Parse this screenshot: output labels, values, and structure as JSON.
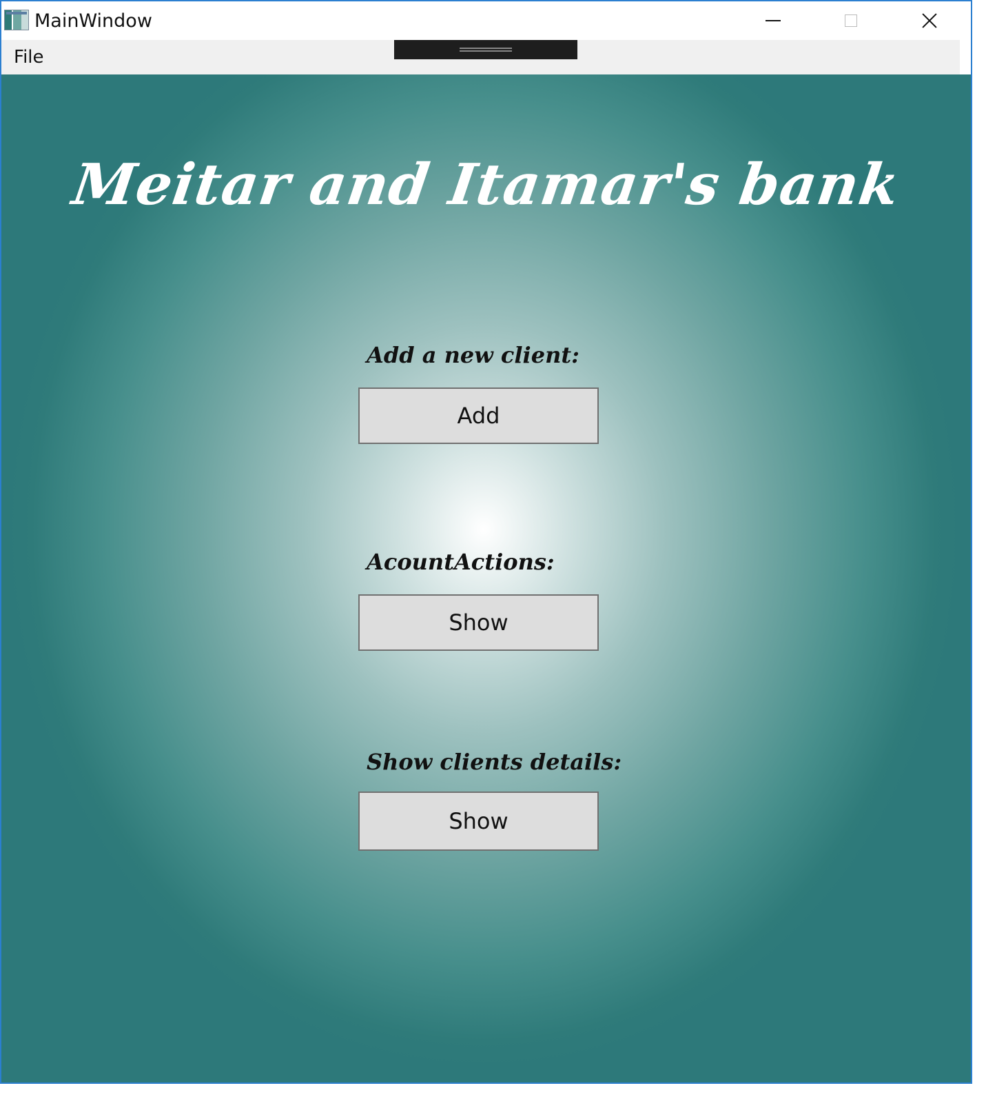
{
  "window": {
    "title": "MainWindow",
    "accent_border_color": "#2b7fd0",
    "controls": {
      "minimize_icon": "minimize-icon",
      "maximize_icon": "maximize-icon",
      "close_icon": "close-icon"
    }
  },
  "menu": {
    "items": [
      {
        "label": "File"
      }
    ]
  },
  "main": {
    "title": "Meitar and Itamar's bank",
    "background_center_color": "#ffffff",
    "background_edge_color": "#2d797a",
    "sections": [
      {
        "label": "Add a new client:",
        "button_label": "Add"
      },
      {
        "label": "AcountActions:",
        "button_label": "Show"
      },
      {
        "label": "Show clients details:",
        "button_label": "Show"
      }
    ]
  }
}
